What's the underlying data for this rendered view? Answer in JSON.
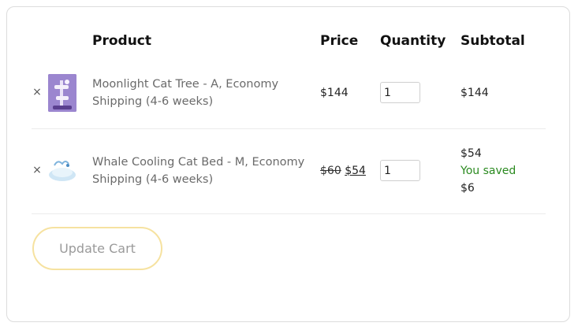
{
  "table": {
    "headers": {
      "product": "Product",
      "price": "Price",
      "quantity": "Quantity",
      "subtotal": "Subtotal"
    }
  },
  "items": [
    {
      "remove_icon": "×",
      "name": "Moonlight Cat Tree - A, Economy Shipping (4-6 weeks)",
      "price": "$144",
      "quantity": "1",
      "subtotal": "$144"
    },
    {
      "remove_icon": "×",
      "name": "Whale Cooling Cat Bed - M, Economy Shipping (4-6 weeks)",
      "price_original": "$60",
      "price_sale": "$54",
      "quantity": "1",
      "subtotal": "$54",
      "saved_label": "You saved",
      "saved_amount": "$6"
    }
  ],
  "actions": {
    "update_cart": "Update Cart"
  },
  "colors": {
    "saved_text": "#2a8a1f",
    "button_border": "#f6e2a0"
  }
}
